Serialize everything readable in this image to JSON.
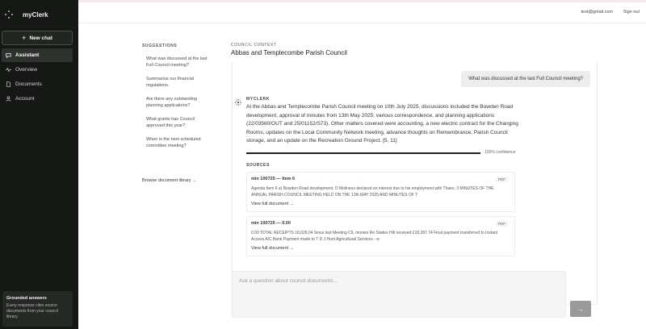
{
  "app": {
    "name": "myClerk"
  },
  "sidebar": {
    "new_chat_label": "New chat",
    "items": [
      {
        "label": "Assistant",
        "icon": "chat-icon",
        "active": true
      },
      {
        "label": "Overview",
        "icon": "pulse-icon",
        "active": false
      },
      {
        "label": "Documents",
        "icon": "document-icon",
        "active": false
      },
      {
        "label": "Account",
        "icon": "user-icon",
        "active": false
      }
    ],
    "grounded": {
      "title": "Grounded answers",
      "text": "Every response cites source documents from your council library."
    }
  },
  "header": {
    "user_email": "test@gmail.com",
    "sign_out_label": "Sign out"
  },
  "suggestions": {
    "heading": "SUGGESTIONS",
    "items": [
      "What was discussed at the last Full Council meeting?",
      "Summarise our financial regulations.",
      "Are there any outstanding planning applications?",
      "What grants has Council approved this year?",
      "When is the next scheduled committee meeting?"
    ],
    "browse_label": "Browse document library →"
  },
  "context": {
    "label": "COUNCIL CONTEXT",
    "title": "Abbas and Templecombe Parish Council"
  },
  "chat": {
    "user_message": "What was discussed at the last Full Council meeting?",
    "bot_name": "MYCLERK",
    "answer": "At the Abbas and Templecombe Parish Council meeting on 10th July 2025, discussions included the Bowden Road development, approval of minutes from 13th May 2025, various correspondence, and planning applications (22/03560/OUT and 25/01152/S73). Other matters covered were accounting, a new electric contract for the Changing Rooms, updates on the Local Community Network meeting, advance thoughts on Remembrance, Parish Council storage, and an update on the Recreation Ground Project. [5, 11]",
    "confidence_value": 100,
    "confidence_label": "100% confidence",
    "sources_heading": "SOURCES",
    "sources": [
      {
        "title": "min 100725 — Item 6",
        "badge": "PDF",
        "snippet": "Agenda Item 6 a) Bowden Road development. D Molineux declared an interest due to his employment with Thaes. 3 MINUTES OF THE ANNUAL PARISH COUNCIL MEETING HELD ON THE 13th MAY 2025 AND MINUTES OF T",
        "link": "View full document →"
      },
      {
        "title": "min 100725 — 0.00",
        "badge": "PDF",
        "snippet": "0.00 TOTAL RECEIPTS 18,026.04 Since last Meeting CIL monies Re Slades Hill received £18,287.74 Final payment transferred to Instant Access A/C Bank Payment made to T D J Hunt Agricultural Services - w",
        "link": "View full document →"
      }
    ]
  },
  "composer": {
    "placeholder": "Ask a question about council documents...",
    "send_icon": "arrow-right-icon"
  }
}
